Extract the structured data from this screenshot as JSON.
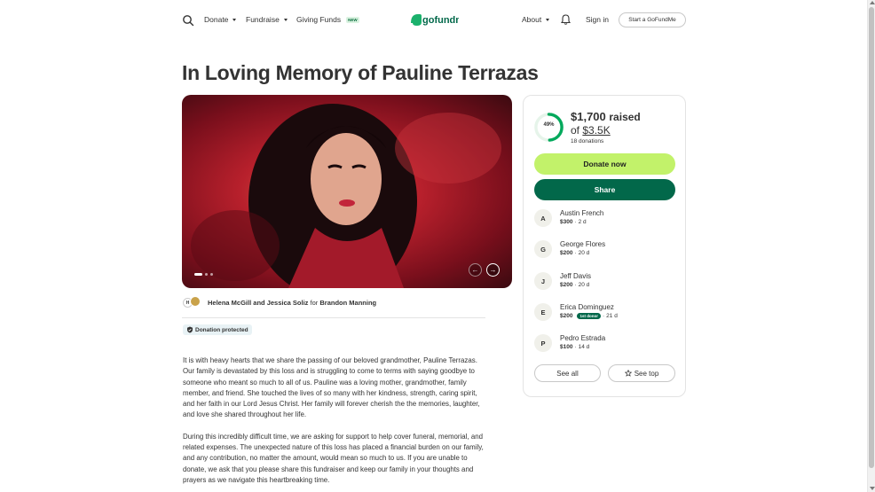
{
  "header": {
    "nav": [
      {
        "label": "Donate"
      },
      {
        "label": "Fundraise"
      },
      {
        "label": "Giving Funds",
        "badge": "NEW"
      }
    ],
    "logo_text": "gofundme",
    "about": "About",
    "sign_in": "Sign in",
    "start_button": "Start a GoFundMe"
  },
  "campaign": {
    "title": "In Loving Memory of Pauline Terrazas",
    "organizers": {
      "name1": "Helena McGill",
      "and": "and",
      "name2": "Jessica Soliz",
      "for": "for",
      "beneficiary": "Brandon Manning"
    },
    "protected_label": "Donation protected",
    "story": [
      "It is with heavy hearts that we share the passing of our beloved grandmother, Pauline Terrazas. Our family is devastated by this loss and is struggling to come to terms with saying goodbye to someone who meant so much to all of us. Pauline was a loving mother, grandmother, family member, and friend. She touched the lives of so many with her kindness, strength, caring spirit, and her faith in our Lord Jesus Christ. Her family will forever cherish the the memories, laughter, and love she shared throughout her life.",
      "During this incredibly difficult time, we are asking for support to help cover funeral, memorial, and related expenses. The unexpected nature of this loss has placed a financial burden on our family, and any contribution, no matter the amount, would mean so much to us. If you are unable to donate, we ask that you please share this fundraiser and keep our family in your thoughts and prayers as we navigate this heartbreaking time."
    ]
  },
  "progress": {
    "percent_label": "49%",
    "percent": 49,
    "raised": "$1,700",
    "raised_label": "raised",
    "goal_prefix": "of",
    "goal": "$3.5K",
    "donations": "18 donations"
  },
  "actions": {
    "donate_now": "Donate now",
    "share": "Share",
    "see_all": "See all",
    "see_top": "See top"
  },
  "donors": [
    {
      "initial": "A",
      "name": "Austin French",
      "amount": "$300",
      "time": "2 d"
    },
    {
      "initial": "G",
      "name": "George Flores",
      "amount": "$200",
      "time": "20 d"
    },
    {
      "initial": "J",
      "name": "Jeff Davis",
      "amount": "$200",
      "time": "20 d"
    },
    {
      "initial": "E",
      "name": "Erica Dominguez",
      "amount": "$200",
      "badge": "1st donor",
      "time": "21 d"
    },
    {
      "initial": "P",
      "name": "Pedro Estrada",
      "amount": "$100",
      "time": "14 d"
    }
  ],
  "colors": {
    "brand_green": "#02684a",
    "cta_lime": "#c2f26a",
    "text": "#333333"
  }
}
